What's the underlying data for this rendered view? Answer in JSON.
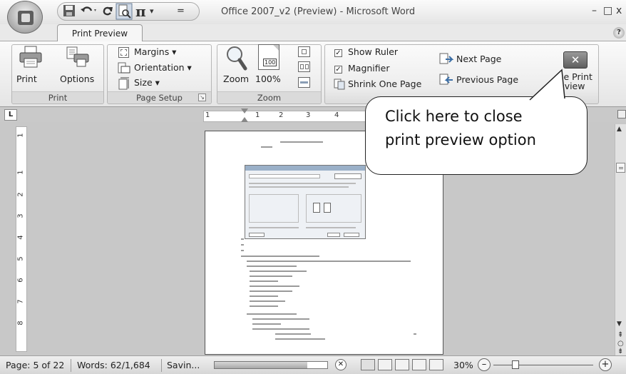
{
  "window": {
    "title": "Office 2007_v2 (Preview) - Microsoft Word",
    "minimize": "–",
    "maximize": "□",
    "close": "x"
  },
  "qat": {
    "save_icon": "save-icon",
    "undo_icon": "undo-icon",
    "redo_icon": "redo-icon",
    "print_preview_icon": "print-preview-icon",
    "equation_symbol": "π",
    "customize_symbol": "="
  },
  "tabs": {
    "active": "Print Preview",
    "help_symbol": "?"
  },
  "ribbon": {
    "print_group": {
      "label": "Print",
      "print_label": "Print",
      "options_label": "Options"
    },
    "page_setup_group": {
      "label": "Page Setup",
      "margins": "Margins ▾",
      "orientation": "Orientation ▾",
      "size": "Size ▾"
    },
    "zoom_group": {
      "label": "Zoom",
      "zoom_label": "Zoom",
      "hundred_label": "100%",
      "page_icon_number": "100"
    },
    "preview_group": {
      "show_ruler": "Show Ruler",
      "magnifier": "Magnifier",
      "shrink_one_page": "Shrink One Page",
      "next_page": "Next Page",
      "previous_page": "Previous Page",
      "close_line1": "se Print",
      "close_line2": "eview"
    }
  },
  "ruler": {
    "corner": "L",
    "numbers": [
      "1",
      "1",
      "2",
      "3",
      "4"
    ],
    "vnumbers": [
      "1",
      "1",
      "2",
      "3",
      "4",
      "5",
      "6",
      "7",
      "8"
    ]
  },
  "callout": {
    "line1": "Click here to close",
    "line2": "print preview option"
  },
  "statusbar": {
    "page": "Page: 5 of 22",
    "words": "Words: 62/1,684",
    "saving": "Savin...",
    "zoom": "30%",
    "minus": "–",
    "plus": "+"
  },
  "colors": {
    "ribbon_bg": "#e9e9e9",
    "workspace_bg": "#c8c8c8",
    "close_button": "#6a6a6a"
  }
}
